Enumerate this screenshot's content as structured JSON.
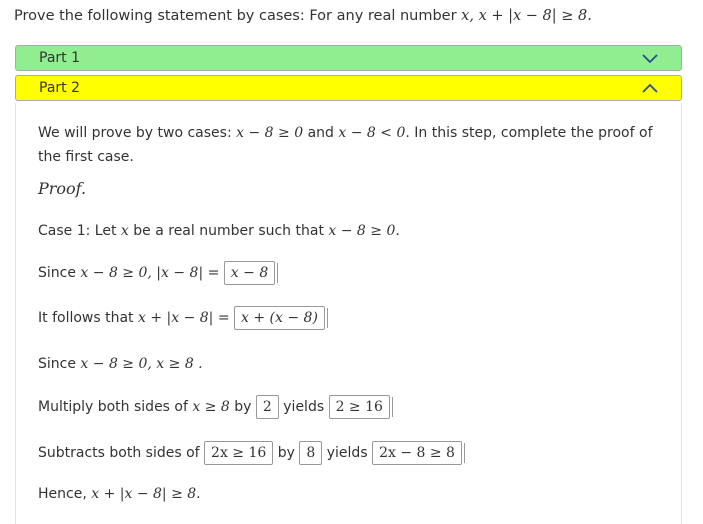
{
  "statement": {
    "prefix": "Prove the following statement by cases: For any real number ",
    "math": "x, x + |x − 8| ≥ 8."
  },
  "parts": [
    {
      "label": "Part 1",
      "color": "#90ee90",
      "icon": "chevron-down-icon"
    },
    {
      "label": "Part 2",
      "color": "#ffff00",
      "icon": "chevron-up-icon"
    }
  ],
  "intro": {
    "t1": "We will prove by two cases: ",
    "m1": "x − 8 ≥ 0",
    "t2": " and ",
    "m2": "x − 8 < 0",
    "t3": ". In this step, complete the proof of the first case."
  },
  "proof_label": "Proof.",
  "case1": {
    "t1": "Case 1: Let ",
    "m1": "x",
    "t2": " be a real number such that ",
    "m2": "x − 8 ≥ 0."
  },
  "since1": {
    "t1": "Since ",
    "m1": "x − 8 ≥ 0, |x − 8| =",
    "box": "x − 8"
  },
  "follows": {
    "t1": "It follows that ",
    "m1": "x + |x − 8| =",
    "box": "x + (x − 8)"
  },
  "since2": {
    "t1": "Since ",
    "m1": "x − 8 ≥ 0, x ≥ 8 ."
  },
  "multiply": {
    "t1": "Multiply both sides of ",
    "m1": "x ≥ 8",
    "t2": " by",
    "box1": "2",
    "t3": "yields",
    "box2": "2 ≥ 16"
  },
  "subtract": {
    "t1": "Subtracts both sides of",
    "box1": "2x ≥ 16",
    "t2": "by",
    "box2": "8",
    "t3": "yields",
    "box3": "2x − 8 ≥ 8"
  },
  "hence": {
    "t1": "Hence, ",
    "m1": "x + |x − 8| ≥ 8."
  }
}
